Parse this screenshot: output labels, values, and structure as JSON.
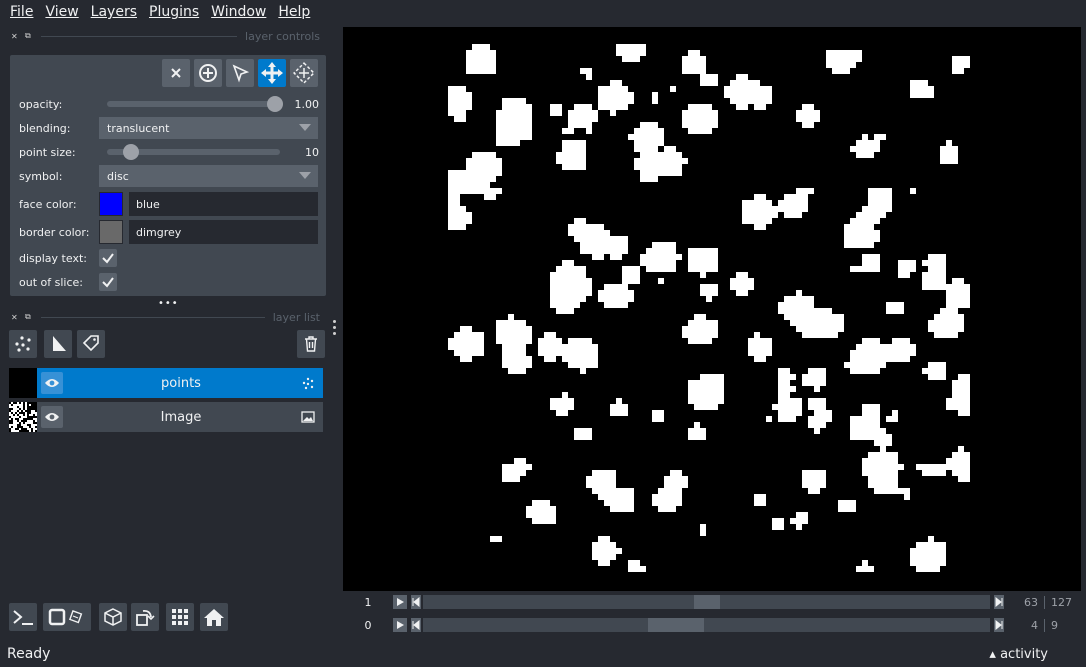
{
  "menu": [
    "File",
    "View",
    "Layers",
    "Plugins",
    "Window",
    "Help"
  ],
  "layer_controls": {
    "title": "layer controls",
    "opacity_label": "opacity:",
    "opacity_value": "1.00",
    "opacity_fraction": 1.0,
    "blending_label": "blending:",
    "blending_value": "translucent",
    "point_size_label": "point size:",
    "point_size_value": "10",
    "point_size_fraction": 0.1,
    "symbol_label": "symbol:",
    "symbol_value": "disc",
    "face_color_label": "face color:",
    "face_color_value": "blue",
    "face_color_hex": "#0000ff",
    "border_color_label": "border color:",
    "border_color_value": "dimgrey",
    "border_color_hex": "#696969",
    "display_text_label": "display text:",
    "display_text_checked": true,
    "out_of_slice_label": "out of slice:",
    "out_of_slice_checked": true,
    "tools": [
      "delete-icon",
      "add-point-icon",
      "select-icon",
      "pan-zoom-icon",
      "transform-icon"
    ],
    "active_tool": "pan-zoom-icon"
  },
  "layer_list": {
    "title": "layer list",
    "layers": [
      {
        "name": "points",
        "type_icon": "points-icon",
        "selected": true,
        "visible": true
      },
      {
        "name": "Image",
        "type_icon": "image-icon",
        "selected": false,
        "visible": true
      }
    ]
  },
  "dims": [
    {
      "index_label": "1",
      "current": "63",
      "total": "127",
      "fraction": 0.5
    },
    {
      "index_label": "0",
      "current": "4",
      "total": "9",
      "fraction": 0.44
    }
  ],
  "status": {
    "text": "Ready",
    "activity": "activity"
  }
}
